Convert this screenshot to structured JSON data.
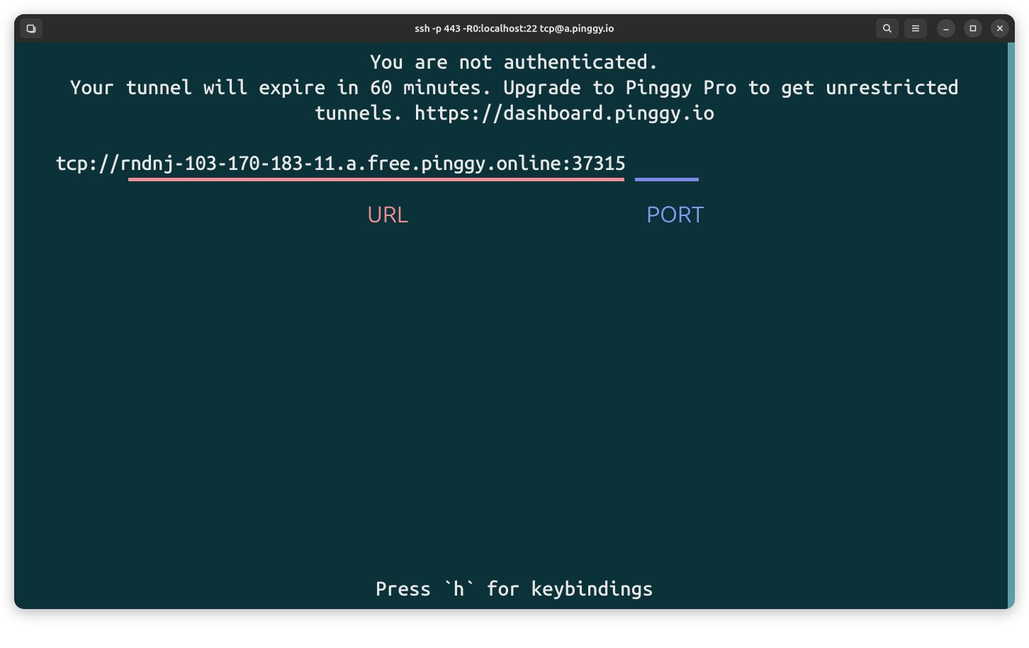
{
  "titlebar": {
    "title": "ssh -p 443 -R0:localhost:22 tcp@a.pinggy.io"
  },
  "terminal": {
    "auth_line": "You are not authenticated.",
    "expire_line": "Your tunnel will expire in 60 minutes. Upgrade to Pinggy Pro to get unrestricted tunnels. https://dashboard.pinggy.io",
    "protocol_prefix": "tcp://",
    "host": "rndnj-103-170-183-11.a.free.pinggy.online",
    "port_separator": ":",
    "port": "37315",
    "url_label": "URL",
    "port_label": "PORT",
    "footer": "Press `h` for keybindings"
  }
}
